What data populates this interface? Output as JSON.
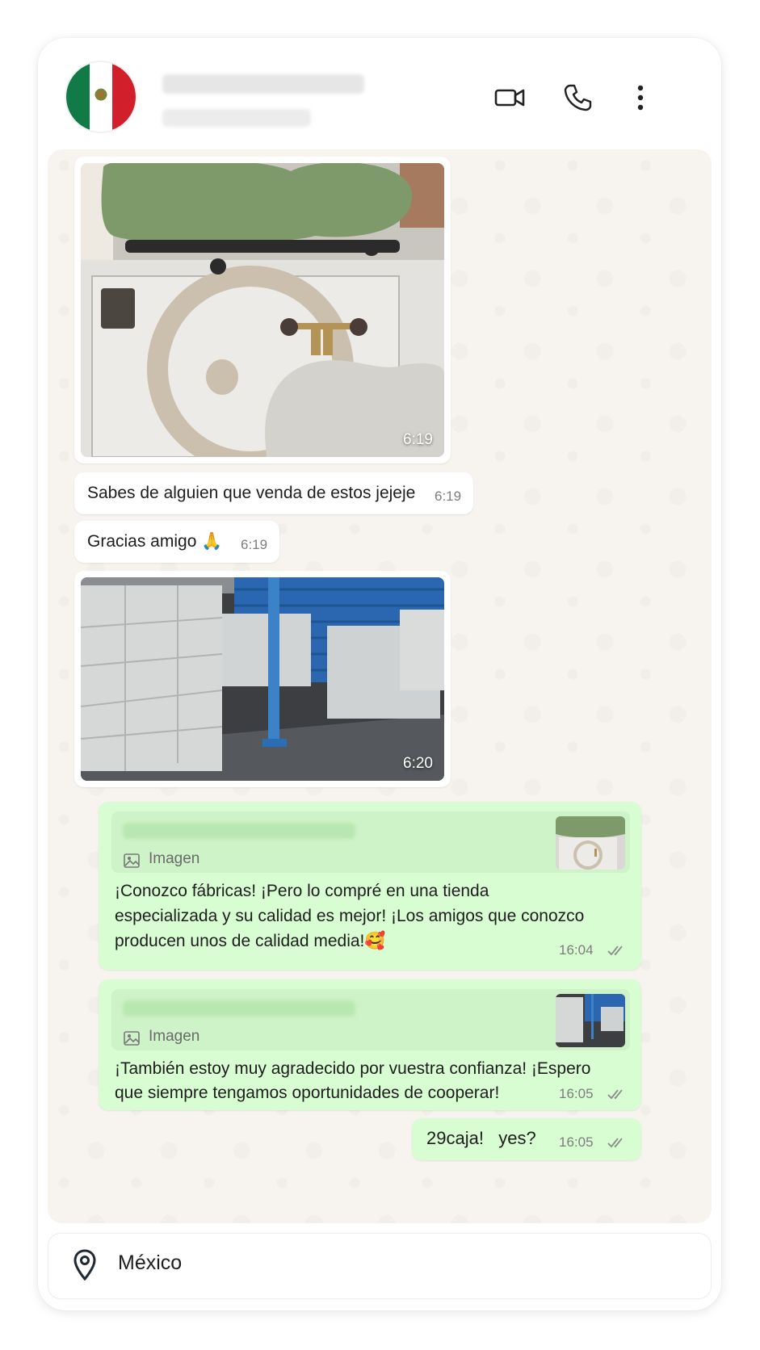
{
  "contact": {
    "avatar_icon": "mexico-flag-icon"
  },
  "header_icons": [
    "video-call-icon",
    "phone-call-icon",
    "more-options-icon"
  ],
  "messages": [
    {
      "type": "image",
      "direction": "in",
      "time": "6:19"
    },
    {
      "type": "text",
      "direction": "in",
      "text": "Sabes de alguien que venda de estos jejeje",
      "time": "6:19"
    },
    {
      "type": "text",
      "direction": "in",
      "text": "Gracias amigo 🙏",
      "time": "6:19"
    },
    {
      "type": "image",
      "direction": "in",
      "time": "6:20"
    },
    {
      "type": "reply",
      "direction": "out",
      "quote_label": "Imagen",
      "lines": [
        "¡Conozco fábricas! ¡Pero lo compré en una tienda",
        "especializada y su calidad es mejor! ¡Los amigos que conozco",
        "producen unos de calidad media!🥰"
      ],
      "time": "16:04",
      "status": "read"
    },
    {
      "type": "reply",
      "direction": "out",
      "quote_label": "Imagen",
      "lines": [
        "¡También estoy muy agradecido por vuestra confianza! ¡Espero",
        "que siempre tengamos oportunidades de cooperar!"
      ],
      "time": "16:05",
      "status": "read"
    },
    {
      "type": "text",
      "direction": "out",
      "text": "29caja!   yes?",
      "time": "16:05",
      "status": "read"
    }
  ],
  "footer": {
    "location": "México",
    "icon": "location-pin-icon"
  },
  "colors": {
    "incoming": "#ffffff",
    "outgoing": "#d9fdd3",
    "chat_bg": "#f7f4ef"
  }
}
